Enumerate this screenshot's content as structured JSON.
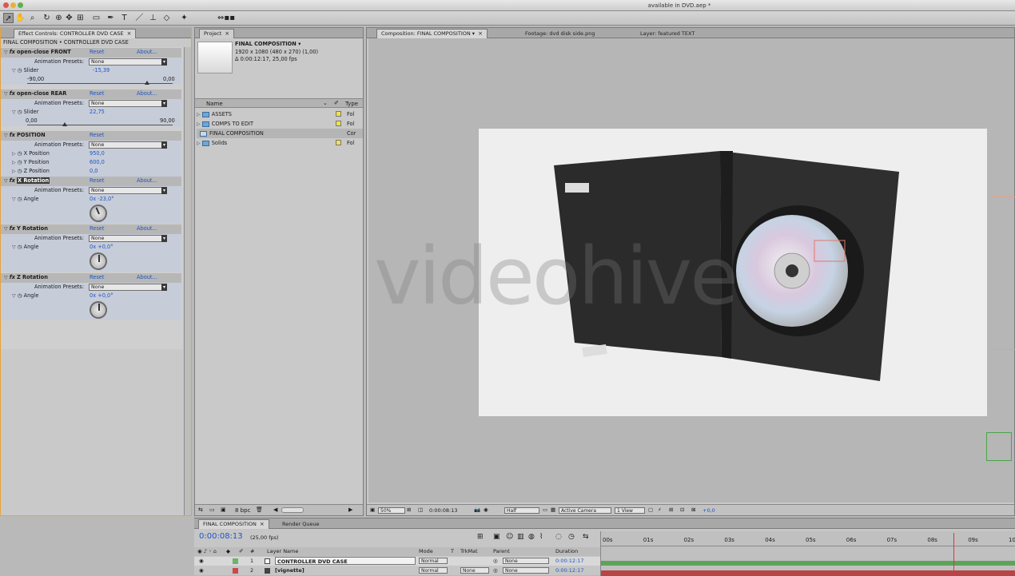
{
  "window": {
    "title": "available in DVD.aep *"
  },
  "effect_controls": {
    "tab_label": "Effect Controls: CONTROLLER DVD CASE",
    "breadcrumb": "FINAL COMPOSITION • CONTROLLER DVD CASE",
    "reset": "Reset",
    "about": "About...",
    "presets_label": "Animation Presets:",
    "presets_value": "None",
    "effects": [
      {
        "name": "open-close FRONT",
        "param": "Slider",
        "value": "-15,39",
        "min": "-90,00",
        "max": "0,00"
      },
      {
        "name": "open-close REAR",
        "param": "Slider",
        "value": "22,75",
        "min": "0,00",
        "max": "90,00"
      },
      {
        "name": "POSITION",
        "params": [
          {
            "label": "X Position",
            "value": "950,0"
          },
          {
            "label": "Y Position",
            "value": "600,0"
          },
          {
            "label": "Z Position",
            "value": "0,0"
          }
        ]
      },
      {
        "name": "X Rotation",
        "param": "Angle",
        "value": "0x -23,0°"
      },
      {
        "name": "Y Rotation",
        "param": "Angle",
        "value": "0x +0,0°"
      },
      {
        "name": "Z Rotation",
        "param": "Angle",
        "value": "0x +0,0°"
      }
    ]
  },
  "project": {
    "tab_label": "Project",
    "comp_name": "FINAL COMPOSITION ▾",
    "comp_size": "1920 x 1080  (480 x 270) (1,00)",
    "comp_duration": "Δ 0:00:12:17, 25,00 fps",
    "col_name": "Name",
    "col_type": "Type",
    "items": [
      {
        "name": "ASSETS",
        "type": "Fol"
      },
      {
        "name": "COMPS TO EDIT",
        "type": "Fol"
      },
      {
        "name": "FINAL COMPOSITION",
        "type": "Cor"
      },
      {
        "name": "Solids",
        "type": "Fol"
      }
    ],
    "bpc": "8 bpc"
  },
  "composition": {
    "tabs": [
      "Composition: FINAL COMPOSITION",
      "Footage: dvd disk side.png",
      "Layer: featured TEXT"
    ],
    "watermark": "videohive",
    "footer": {
      "zoom": "50%",
      "timecode": "0:00:08:13",
      "resolution": "Half",
      "camera": "Active Camera",
      "views": "1 View",
      "exposure": "+0,0"
    }
  },
  "timeline": {
    "tabs": [
      "FINAL COMPOSITION",
      "Render Queue"
    ],
    "timecode": "0:00:08:13",
    "fps": "(25,00 fps)",
    "columns": {
      "num": "#",
      "layer_name": "Layer Name",
      "mode": "Mode",
      "t": "T",
      "trkmat": "TrkMat",
      "parent": "Parent",
      "duration": "Duration"
    },
    "ruler": [
      "00s",
      "01s",
      "02s",
      "03s",
      "04s",
      "05s",
      "06s",
      "07s",
      "08s",
      "09s",
      "10s"
    ],
    "playhead_seconds": 8.52,
    "layers": [
      {
        "num": "1",
        "name": "CONTROLLER DVD CASE",
        "mode": "Normal",
        "trkmat": "",
        "parent": "None",
        "duration": "0:00:12:17",
        "label_color": "#6ab56a",
        "bar_color": "#5fa35a"
      },
      {
        "num": "2",
        "name": "[vignette]",
        "mode": "Normal",
        "trkmat": "None",
        "parent": "None",
        "duration": "0:00:12:17",
        "label_color": "#c94a4a",
        "bar_color": "#b84545"
      }
    ]
  }
}
